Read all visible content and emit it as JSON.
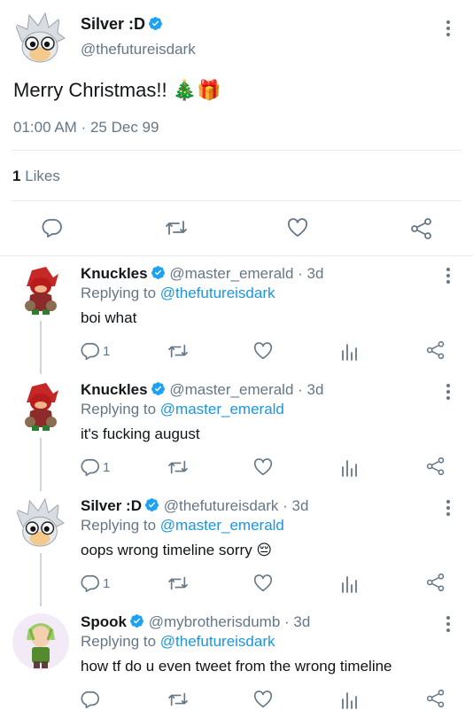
{
  "main_tweet": {
    "display_name": "Silver :D",
    "handle": "@thefutureisdark",
    "text": "Merry Christmas!! 🎄🎁",
    "time": "01:00 AM",
    "separator": "·",
    "date": "25 Dec 99",
    "likes_count": "1",
    "likes_label": "Likes"
  },
  "replies": [
    {
      "display_name": "Knuckles",
      "handle": "@master_emerald",
      "age": "· 3d",
      "replying_prefix": "Replying to",
      "replying_to": "@thefutureisdark",
      "text": "boi what",
      "reply_count": "1",
      "avatar": "knuckles-avatar"
    },
    {
      "display_name": "Knuckles",
      "handle": "@master_emerald",
      "age": "· 3d",
      "replying_prefix": "Replying to",
      "replying_to": "@master_emerald",
      "text": "it's fucking august",
      "reply_count": "1",
      "avatar": "knuckles-avatar"
    },
    {
      "display_name": "Silver :D",
      "handle": "@thefutureisdark",
      "age": "· 3d",
      "replying_prefix": "Replying to",
      "replying_to": "@master_emerald",
      "text": "oops wrong timeline sorry 😔",
      "reply_count": "1",
      "avatar": "silver-avatar"
    },
    {
      "display_name": "Spook",
      "handle": "@mybrotherisdumb",
      "age": "· 3d",
      "replying_prefix": "Replying to",
      "replying_to": "@thefutureisdark",
      "text": "how tf do u even tweet from the wrong timeline",
      "reply_count": "",
      "avatar": "spook-avatar"
    }
  ],
  "icons": {
    "reply": "reply-bubble-icon",
    "retweet": "retweet-icon",
    "like": "heart-icon",
    "analytics": "analytics-bar-icon",
    "share": "share-icon",
    "more": "more-vertical-icon",
    "verified": "verified-badge-icon"
  },
  "colors": {
    "accent": "#1b95e0",
    "muted": "#657786",
    "divider": "#e6ecf0"
  }
}
